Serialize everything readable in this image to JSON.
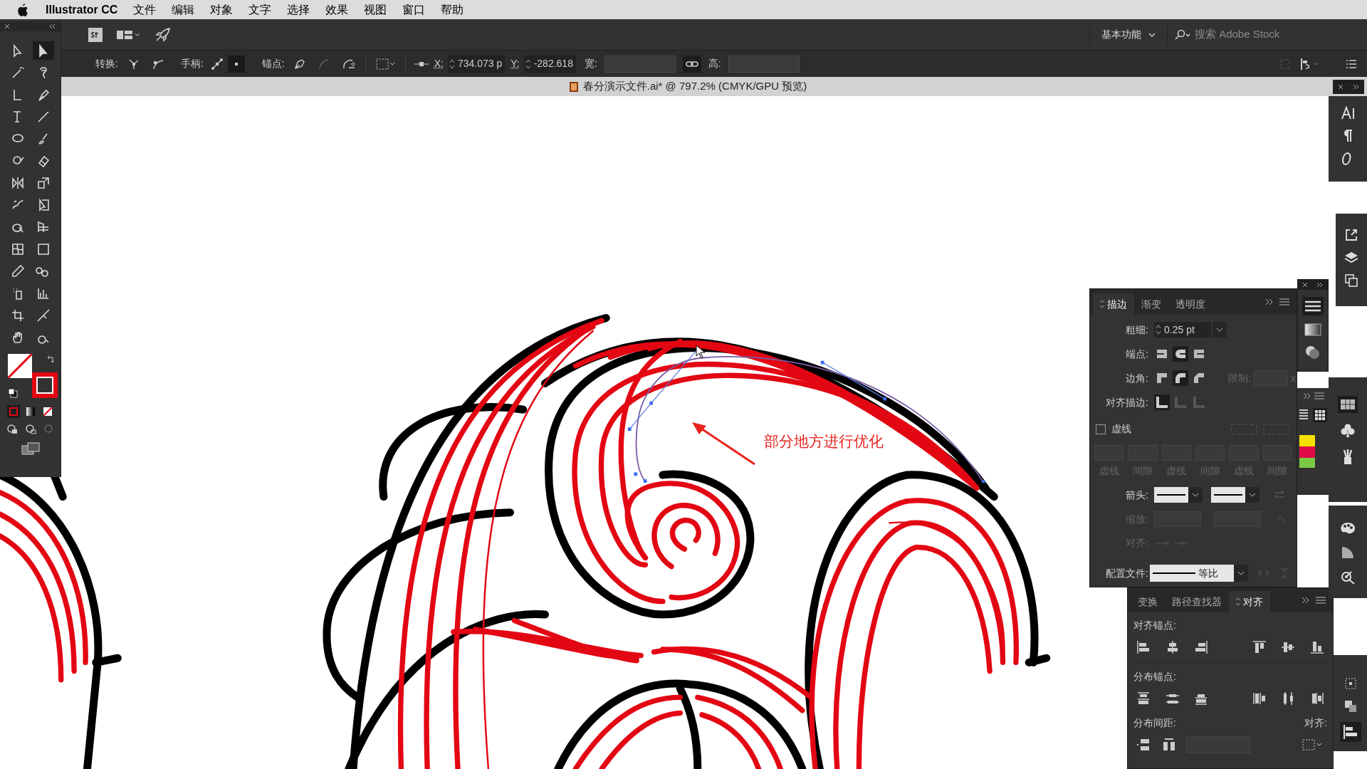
{
  "menu_bar": {
    "app_name": "Illustrator CC",
    "items": [
      "文件",
      "编辑",
      "对象",
      "文字",
      "选择",
      "效果",
      "视图",
      "窗口",
      "帮助"
    ]
  },
  "app_bar": {
    "workspace": "基本功能",
    "search": {
      "placeholder": "搜索 Adobe Stock"
    }
  },
  "control_bar": {
    "convert_label": "转换:",
    "handles_label": "手柄:",
    "anchors_label": "锚点:",
    "x_label": "X:",
    "x_value": "734.073 p",
    "y_label": "Y:",
    "y_value": "-282.618",
    "width_label": "宽:",
    "height_label": "高:"
  },
  "document_tab": {
    "title": "春分演示文件.ai* @ 797.2% (CMYK/GPU 预览)"
  },
  "canvas": {
    "annotation": "部分地方进行优化"
  },
  "stroke_panel": {
    "tabs": [
      {
        "label": "描边",
        "selected": true
      },
      {
        "label": "渐变",
        "selected": false
      },
      {
        "label": "透明度",
        "selected": false
      }
    ],
    "weight_label": "粗细:",
    "weight_value": "0.25 pt",
    "cap_label": "端点:",
    "corner_label": "边角:",
    "limit_label": "限制:",
    "limit_suffix": "x",
    "align_label": "对齐描边:",
    "dashed": {
      "label": "虚线",
      "checked": false
    },
    "dash_fields": [
      "虚线",
      "间隙",
      "虚线",
      "间隙",
      "虚线",
      "间隙"
    ],
    "arrow_label": "箭头:",
    "scale_label": "缩放:",
    "arrow_align_label": "对齐:",
    "profile_label": "配置文件:",
    "profile_value": "等比"
  },
  "align_panel": {
    "tabs": [
      {
        "label": "变换",
        "selected": false
      },
      {
        "label": "路径查找器",
        "selected": false
      },
      {
        "label": "对齐",
        "selected": true
      }
    ],
    "align_anchors_label": "对齐锚点:",
    "distribute_anchors_label": "分布锚点:",
    "distribute_spacing_label": "分布间距:",
    "align_to_label": "对齐:"
  }
}
